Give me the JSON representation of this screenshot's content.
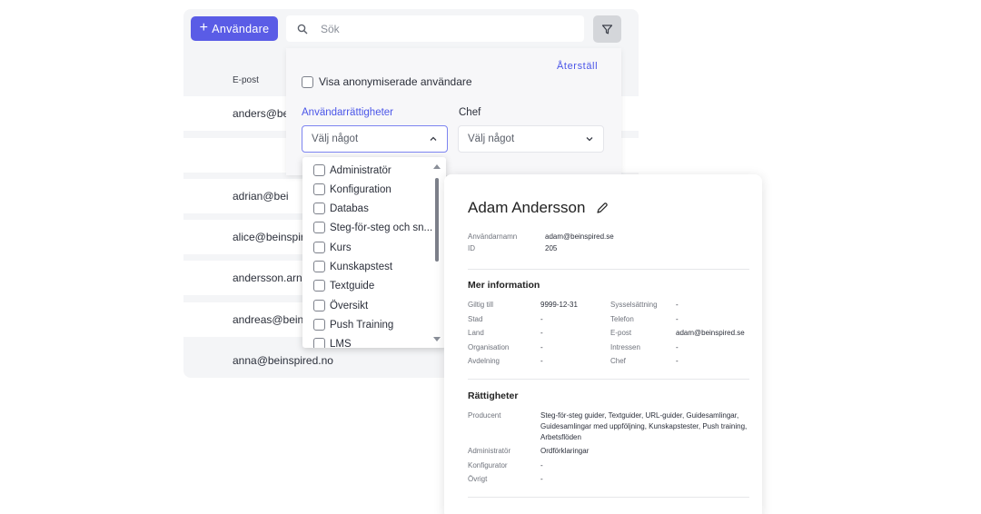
{
  "toolbar": {
    "add_user_label": "Användare",
    "search_placeholder": "Sök"
  },
  "table": {
    "email_header": "E-post",
    "rows": [
      "anders@bei",
      "",
      "adrian@bei",
      "alice@beinspire",
      "andersson.arna",
      "andreas@beins",
      "anna@beinspired.no"
    ]
  },
  "filter": {
    "reset_label": "Återställ",
    "anon_label": "Visa anonymiserade användare",
    "rights_label": "Användarrättigheter",
    "chef_label": "Chef",
    "rights_value": "Välj något",
    "chef_value": "Välj något",
    "options": [
      "Administratör",
      "Konfiguration",
      "Databas",
      "Steg-för-steg och sn...",
      "Kurs",
      "Kunskapstest",
      "Textguide",
      "Översikt",
      "Push Training",
      "LMS"
    ]
  },
  "profile": {
    "name": "Adam Andersson",
    "username_label": "Användarnamn",
    "username": "adam@beinspired.se",
    "id_label": "ID",
    "id": "205",
    "more_title": "Mer information",
    "left_fields": [
      {
        "label": "Giltig till",
        "value": "9999-12-31"
      },
      {
        "label": "Stad",
        "value": "-"
      },
      {
        "label": "Land",
        "value": "-"
      },
      {
        "label": "Organisation",
        "value": "-"
      },
      {
        "label": "Avdelning",
        "value": "-"
      }
    ],
    "right_fields": [
      {
        "label": "Sysselsättning",
        "value": "-"
      },
      {
        "label": "Telefon",
        "value": "-"
      },
      {
        "label": "E-post",
        "value": "adam@beinspired.se"
      },
      {
        "label": "Intressen",
        "value": "-"
      },
      {
        "label": "Chef",
        "value": "-"
      }
    ],
    "rights_title": "Rättigheter",
    "rights": [
      {
        "label": "Producent",
        "lines": [
          "Steg-för-steg guider, Textguider, URL-guider, Guidesamlingar,",
          "Guidesamlingar med uppföljning, Kunskapstester, Push training,",
          "Arbetsflöden"
        ]
      },
      {
        "label": "Administratör",
        "lines": [
          "Ordförklaringar"
        ]
      },
      {
        "label": "Konfigurator",
        "lines": [
          "-"
        ]
      },
      {
        "label": "Övrigt",
        "lines": [
          "-"
        ]
      }
    ]
  },
  "colors": {
    "accent": "#5a5ce6",
    "link": "#4a55e8"
  }
}
